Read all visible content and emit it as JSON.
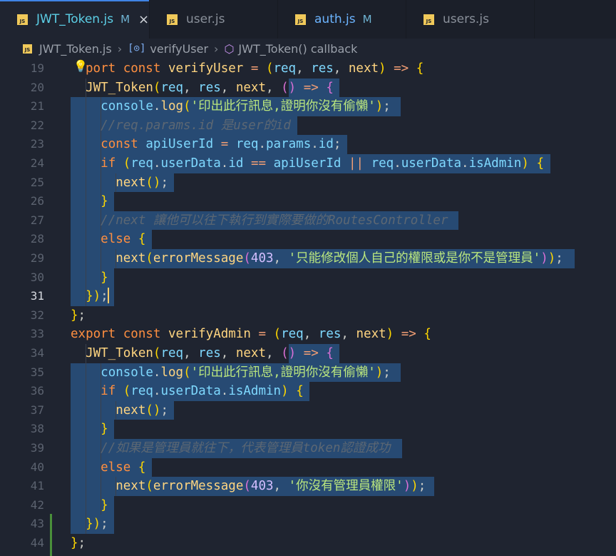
{
  "tabs": [
    {
      "label": "JWT_Token.js",
      "modified": "M",
      "close": "×",
      "active": true
    },
    {
      "label": "user.js",
      "modified": "",
      "active": false
    },
    {
      "label": "auth.js",
      "modified": "M",
      "active": false
    },
    {
      "label": "users.js",
      "modified": "",
      "active": false
    }
  ],
  "breadcrumb": {
    "file": "JWT_Token.js",
    "symbol": "verifyUser",
    "callback": "JWT_Token() callback"
  },
  "editor": {
    "current_line": 31,
    "line_numbers": [
      "19",
      "20",
      "21",
      "22",
      "23",
      "24",
      "25",
      "26",
      "27",
      "28",
      "29",
      "30",
      "31",
      "32",
      "33",
      "34",
      "35",
      "36",
      "37",
      "38",
      "39",
      "40",
      "41",
      "42",
      "43",
      "44"
    ],
    "lines": [
      "port const verifyUser = (req, res, next) => {",
      "  JWT_Token(req, res, next, () => {",
      "    console.log('印出此行訊息,證明你沒有偷懶');",
      "    //req.params.id 是user的id",
      "    const apiUserId = req.params.id;",
      "    if (req.userData.id == apiUserId || req.userData.isAdmin) {",
      "      next();",
      "    }",
      "    //next 讓他可以往下執行到實際要做的RoutesController",
      "    else {",
      "      next(errorMessage(403, '只能修改個人自己的權限或是你不是管理員'));",
      "    }",
      "  });",
      "};",
      "export const verifyAdmin = (req, res, next) => {",
      "  JWT_Token(req, res, next, () => {",
      "    console.log('印出此行訊息,證明你沒有偷懶');",
      "    if (req.userData.isAdmin) {",
      "      next();",
      "    }",
      "    //如果是管理員就往下，代表管理員token認證成功",
      "    else {",
      "      next(errorMessage(403, '你沒有管理員權限'));",
      "    }",
      "  });",
      "};"
    ]
  },
  "colors": {
    "background": "#1f2430",
    "selection": "#274a73",
    "keyword": "#ff8f40",
    "function": "#ffd580",
    "string": "#bae67e",
    "comment": "#5c6773",
    "tab_accent": "#3f84e5",
    "git_added": "#4a8f3a"
  },
  "icons": [
    "js-file-icon",
    "symbol-variable-icon",
    "symbol-method-cube-icon",
    "lightbulb-icon",
    "close-icon"
  ]
}
